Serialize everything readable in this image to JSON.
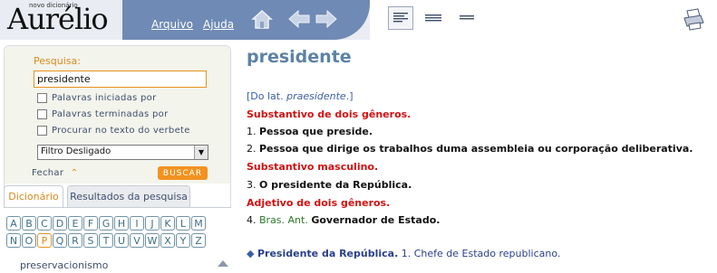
{
  "header": {
    "logo_small": "novo dicionário",
    "logo": "Aurélio",
    "menu": {
      "arquivo": "Arquivo",
      "ajuda": "Ajuda"
    },
    "icons": [
      "home-icon",
      "arrow-left-icon",
      "arrow-right-icon",
      "view-full-icon",
      "view-medium-icon",
      "view-compact-icon",
      "print-icon"
    ],
    "colors": {
      "header_blue": "#6f8ab5",
      "accent_orange": "#f2921f"
    }
  },
  "search": {
    "label": "Pesquisa:",
    "value": "presidente",
    "options": [
      "Palavras iniciadas por",
      "Palavras terminadas por",
      "Procurar no texto do verbete"
    ],
    "filter_selected": "Filtro Desligado",
    "close_label": "Fechar",
    "close_icon": "⌃",
    "search_button": "BUSCAR"
  },
  "tabs": [
    "Dicionário",
    "Resultados da pesquisa"
  ],
  "alphabet": {
    "row1": [
      "A",
      "B",
      "C",
      "D",
      "E",
      "F",
      "G",
      "H",
      "I",
      "J",
      "K",
      "L",
      "M"
    ],
    "row2": [
      "N",
      "O",
      "P",
      "Q",
      "R",
      "S",
      "T",
      "U",
      "V",
      "W",
      "X",
      "Y",
      "Z"
    ],
    "selected": "P"
  },
  "word_list": {
    "visible_item": "preservacionismo"
  },
  "entry": {
    "headword": "presidente",
    "etymology_prefix": "[Do lat. ",
    "etymology_word": "praesidente",
    "etymology_suffix": ".]",
    "cat1": "Substantivo de dois gêneros.",
    "def1_num": "1.",
    "def1": "Pessoa que preside.",
    "def2_num": "2.",
    "def2": "Pessoa que dirige os trabalhos duma assembleia ou corporação deliberativa.",
    "cat2": "Substantivo masculino.",
    "def3_num": "3.",
    "def3": "O presidente da República.",
    "cat3": "Adjetivo de dois gêneros.",
    "def4_num": "4.",
    "def4_tag": "Bras. Ant.",
    "def4": "Governador de Estado.",
    "bullet": "◆",
    "locution": "Presidente da República.",
    "locution_def_num": "1.",
    "locution_def": "Chefe de Estado republicano."
  }
}
